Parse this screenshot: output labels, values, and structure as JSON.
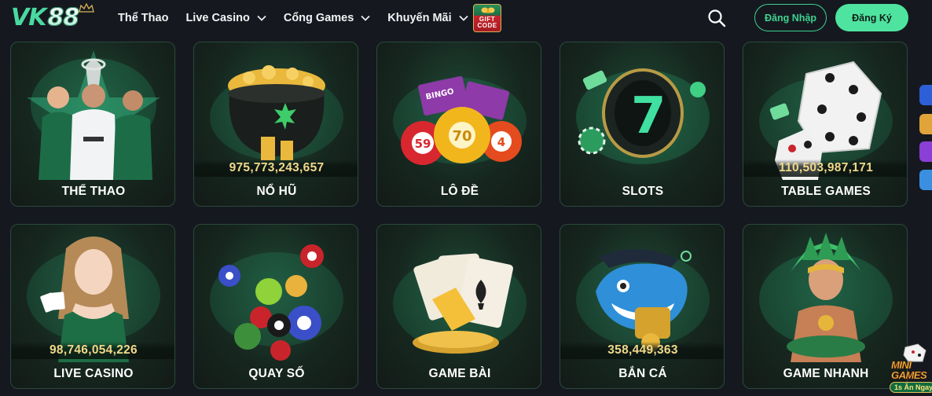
{
  "brand": {
    "logo_text": "VK88",
    "accent": "#4fe3a0"
  },
  "nav": {
    "items": [
      {
        "label": "Thể Thao",
        "has_dropdown": false
      },
      {
        "label": "Live Casino",
        "has_dropdown": true
      },
      {
        "label": "Cổng Games",
        "has_dropdown": true
      },
      {
        "label": "Khuyến Mãi",
        "has_dropdown": true
      }
    ],
    "gift_badge_line1": "GIFT",
    "gift_badge_line2": "CODE"
  },
  "auth": {
    "login_label": "Đăng Nhập",
    "register_label": "Đăng Ký"
  },
  "icons": {
    "search": "search-icon",
    "chevron": "chevron-down-icon",
    "side": [
      "facebook-icon",
      "user-support-icon",
      "messenger-icon",
      "telegram-icon"
    ]
  },
  "games": [
    {
      "title": "THỂ THAO",
      "jackpot": ""
    },
    {
      "title": "NỔ HŨ",
      "jackpot": "975,773,243,657"
    },
    {
      "title": "LÔ ĐỀ",
      "jackpot": ""
    },
    {
      "title": "SLOTS",
      "jackpot": ""
    },
    {
      "title": "TABLE GAMES",
      "jackpot": "110,503,987,171"
    },
    {
      "title": "LIVE CASINO",
      "jackpot": "98,746,054,226"
    },
    {
      "title": "QUAY SỐ",
      "jackpot": ""
    },
    {
      "title": "GAME BÀI",
      "jackpot": ""
    },
    {
      "title": "BẮN CÁ",
      "jackpot": "358,449,363"
    },
    {
      "title": "GAME NHANH",
      "jackpot": ""
    }
  ],
  "art": {
    "lode_balls": [
      "59",
      "70",
      "4"
    ],
    "bingo_text": "BINGO"
  },
  "minigame": {
    "label_line1": "MINI",
    "label_line2": "GAMES",
    "sub": "1s Ăn Ngay"
  },
  "colors": {
    "background": "#15191f",
    "jackpot": "#f0d98a",
    "card_border": "#2a4a3b"
  }
}
